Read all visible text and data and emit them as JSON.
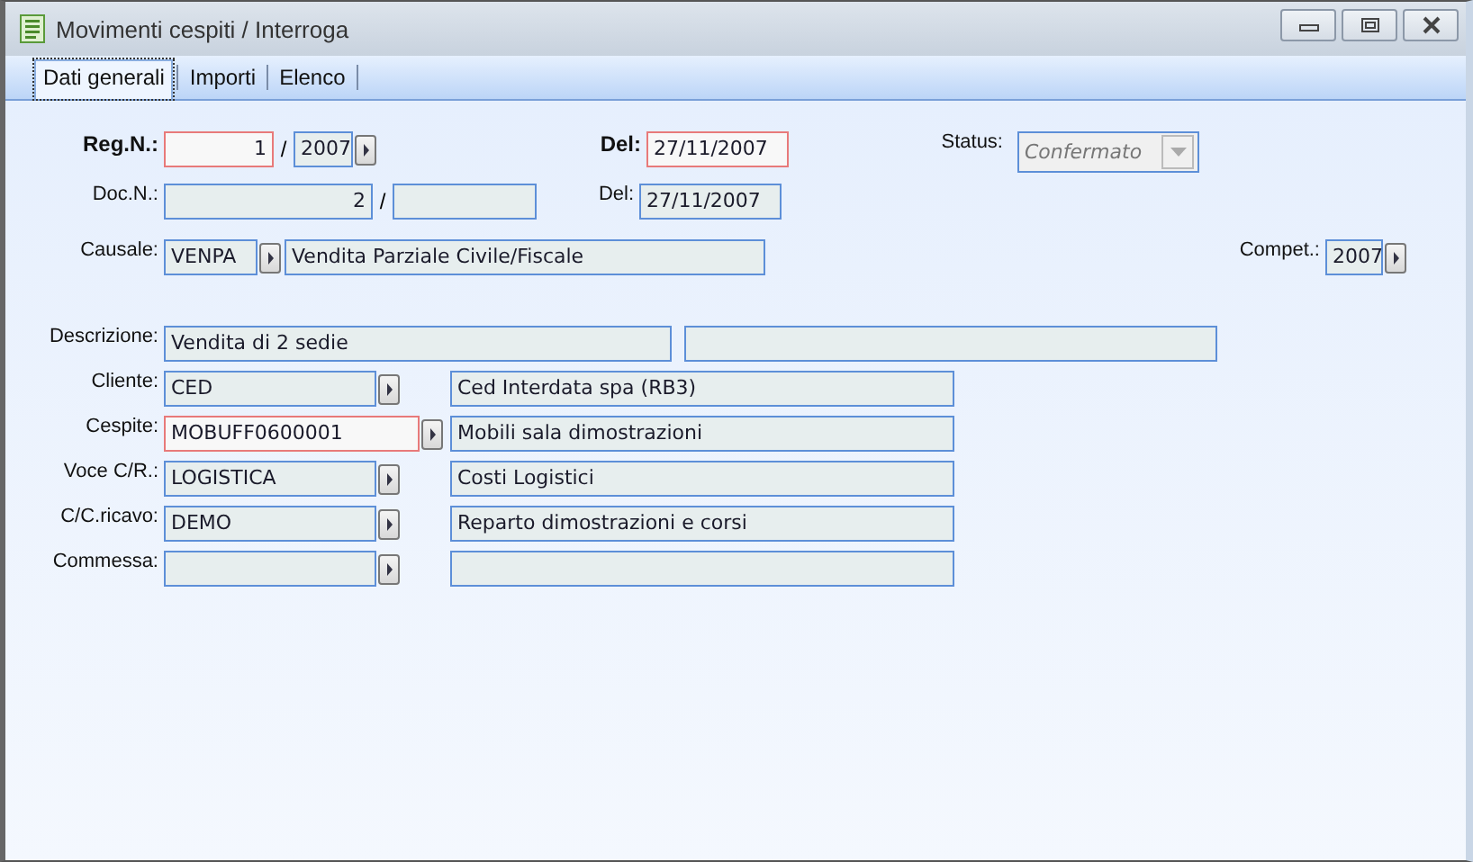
{
  "window": {
    "title": "Movimenti cespiti / Interroga"
  },
  "tabs": [
    {
      "label": "Dati generali",
      "selected": true
    },
    {
      "label": "Importi",
      "selected": false
    },
    {
      "label": "Elenco",
      "selected": false
    }
  ],
  "registration": {
    "label": "Reg.N.:",
    "number": {
      "value": "1",
      "required": true,
      "editable": true
    },
    "separator": "/",
    "year": "2007",
    "date_label": "Del:",
    "date": {
      "value": "27/11/2007",
      "required": true,
      "editable": true
    }
  },
  "status": {
    "label": "Status:",
    "value": "Confermato",
    "disabled": true
  },
  "document": {
    "label": "Doc.N.:",
    "number": "2",
    "separator": "/",
    "date_label": "Del:",
    "date": "27/11/2007"
  },
  "causale": {
    "label": "Causale:",
    "code": "VENPA",
    "description": "Vendita Parziale Civile/Fiscale"
  },
  "competence": {
    "label": "Compet.:",
    "year": "2007"
  },
  "description": {
    "label": "Descrizione:",
    "value": "Vendita di 2 sedie"
  },
  "links": [
    {
      "label": "Cliente:",
      "code": "CED",
      "description": "Ced Interdata spa (RB3)",
      "required": false,
      "editable": false
    },
    {
      "label": "Cespite:",
      "code": "MOBUFF0600001",
      "description": "Mobili sala dimostrazioni",
      "required": true,
      "editable": true
    },
    {
      "label": "Voce C/R.:",
      "code": "LOGISTICA",
      "description": "Costi Logistici",
      "required": false,
      "editable": false
    },
    {
      "label": "C/C.ricavo:",
      "code": "DEMO",
      "description": "Reparto dimostrazioni e corsi",
      "required": false,
      "editable": false
    },
    {
      "label": "Commessa:",
      "required": false,
      "editable": false
    }
  ]
}
